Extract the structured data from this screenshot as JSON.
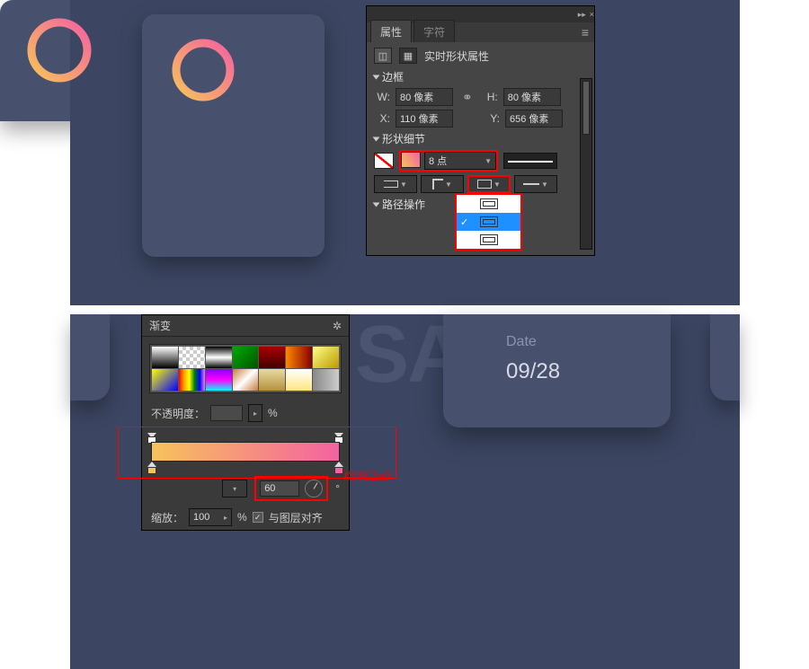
{
  "panel": {
    "tab_active": "属性",
    "tab_inactive": "字符",
    "title": "实时形状属性",
    "menu_icon": "≡",
    "collapse_icon": "▸▸",
    "close_icon": "×",
    "section_bbox": "边框",
    "w_label": "W:",
    "w_value": "80 像素",
    "link_icon": "⚭",
    "h_label": "H:",
    "h_value": "80 像素",
    "x_label": "X:",
    "x_value": "110 像素",
    "y_label": "Y:",
    "y_value": "656 像素",
    "section_detail": "形状细节",
    "stroke_value": "8 点",
    "section_pathops": "路径操作",
    "align_options": [
      "outer",
      "center",
      "inner"
    ]
  },
  "gradient": {
    "title": "渐变",
    "gear_icon": "✲",
    "opacity_label": "不透明度：",
    "opacity_unit": "%",
    "angle_value": "60",
    "degree_unit": "°",
    "scale_label": "缩放：",
    "scale_value": "100",
    "align_label": "与图层对齐",
    "align_checked": "✓",
    "color_annot": "#f462a0",
    "presets": [
      "linear-gradient(#fff,#000)",
      "repeating-conic-gradient(#ccc 0 25%, #fff 0 50%) 0 0/8px 8px",
      "linear-gradient(#000,#fff 50%,#000)",
      "linear-gradient(135deg,#0a0,#050)",
      "linear-gradient(#a00,#400)",
      "linear-gradient(90deg,#f80,#800)",
      "linear-gradient(135deg,#ff8,#b90)",
      "linear-gradient(135deg,#ff0,#00f)",
      "linear-gradient(90deg,red,orange,yellow,green,blue,violet)",
      "linear-gradient(#80f,#f0f,#0ff)",
      "linear-gradient(135deg,#c97b3c,#fff,#c97b3c)",
      "linear-gradient(#e7d9a3,#b5923c)",
      "linear-gradient(#fff,#ffe680)",
      "linear-gradient(90deg,#888,#ccc)"
    ]
  },
  "preview": {
    "date_label": "Date",
    "date_value": "09/28",
    "bg_text": "SA"
  }
}
